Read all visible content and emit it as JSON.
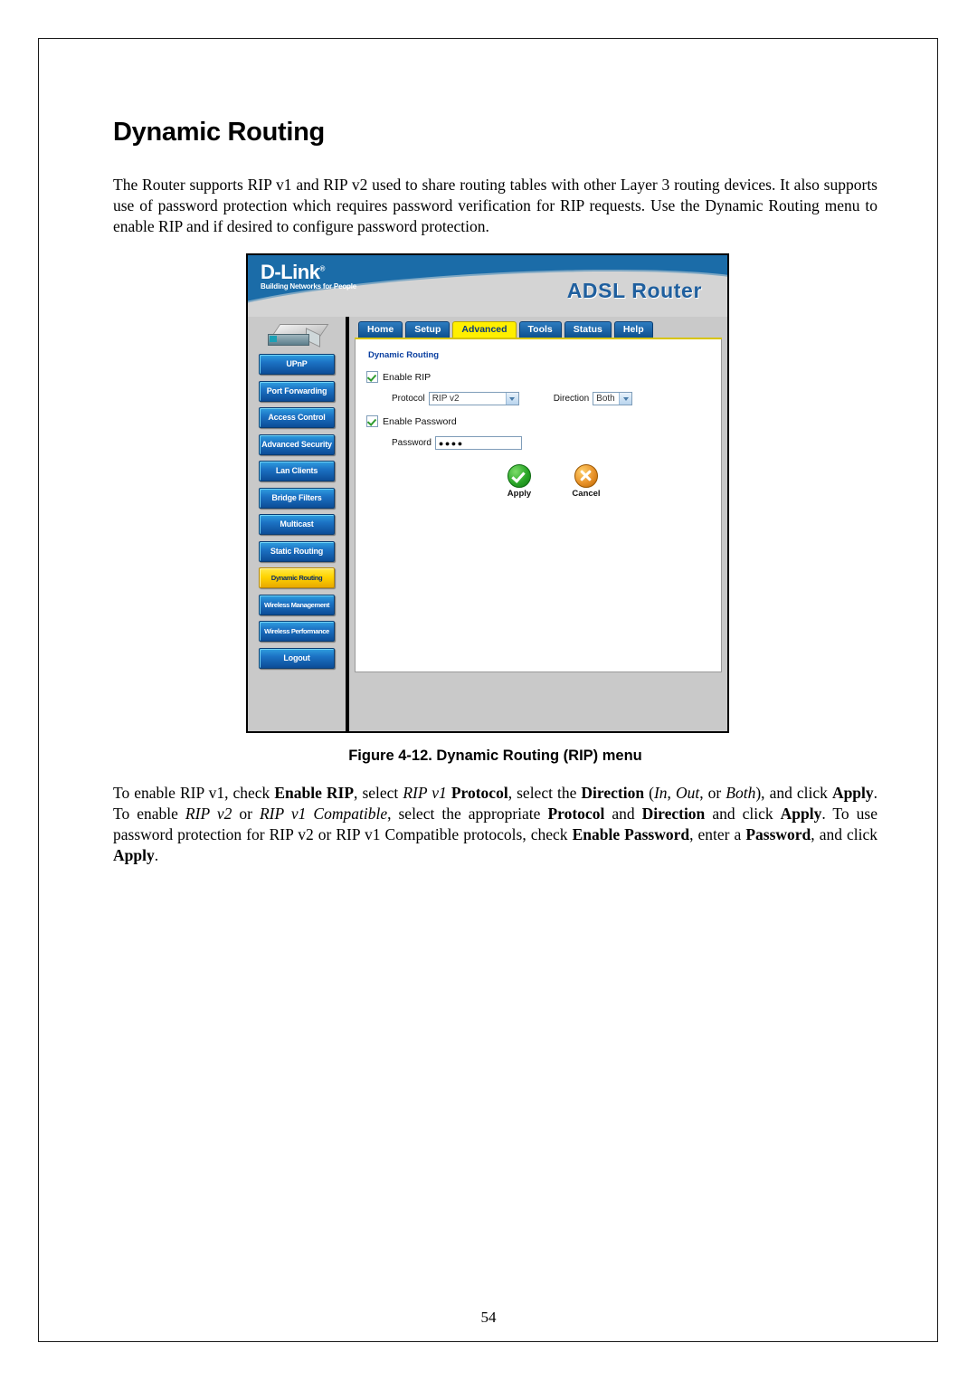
{
  "document": {
    "heading": "Dynamic Routing",
    "intro_paragraph": "The Router supports RIP v1 and RIP v2 used to share routing tables with other Layer 3 routing devices. It also supports use of password protection which requires password verification for RIP requests. Use the Dynamic Routing menu to enable RIP and if desired to configure password protection.",
    "figure_caption": "Figure 4-12. Dynamic Routing (RIP) menu",
    "page_number": "54"
  },
  "router_ui": {
    "brand": {
      "name": "D-Link",
      "trademark": "®",
      "tagline": "Building Networks for People",
      "product_title": "ADSL Router"
    },
    "tabs": [
      {
        "label": "Home",
        "active": false
      },
      {
        "label": "Setup",
        "active": false
      },
      {
        "label": "Advanced",
        "active": true
      },
      {
        "label": "Tools",
        "active": false
      },
      {
        "label": "Status",
        "active": false
      },
      {
        "label": "Help",
        "active": false
      }
    ],
    "sidebar": {
      "device_icon": "router-device-icon",
      "items": [
        {
          "label": "UPnP",
          "active": false,
          "small": false
        },
        {
          "label": "Port Forwarding",
          "active": false,
          "small": false
        },
        {
          "label": "Access Control",
          "active": false,
          "small": false
        },
        {
          "label": "Advanced Security",
          "active": false,
          "small": false
        },
        {
          "label": "Lan Clients",
          "active": false,
          "small": false
        },
        {
          "label": "Bridge Filters",
          "active": false,
          "small": false
        },
        {
          "label": "Multicast",
          "active": false,
          "small": false
        },
        {
          "label": "Static Routing",
          "active": false,
          "small": false
        },
        {
          "label": "Dynamic Routing",
          "active": true,
          "small": true
        },
        {
          "label": "Wireless Management",
          "active": false,
          "small": true
        },
        {
          "label": "Wireless Performance",
          "active": false,
          "small": true
        },
        {
          "label": "Logout",
          "active": false,
          "small": false
        }
      ]
    },
    "panel": {
      "title": "Dynamic Routing",
      "enable_rip_label": "Enable RIP",
      "enable_rip_checked": true,
      "protocol_label": "Protocol",
      "protocol_value": "RIP v2",
      "protocol_options": [
        "RIP v1",
        "RIP v2",
        "RIP v1 Compatible"
      ],
      "direction_label": "Direction",
      "direction_value": "Both",
      "direction_options": [
        "In",
        "Out",
        "Both"
      ],
      "enable_password_label": "Enable Password",
      "enable_password_checked": true,
      "password_label": "Password",
      "password_value": "●●●●",
      "apply_label": "Apply",
      "cancel_label": "Cancel"
    },
    "colors": {
      "header_blue": "#1b6ca8",
      "tab_active_yellow": "#ffef00",
      "sidebar_active_yellow": "#ffd400",
      "panel_title_blue": "#0a3fa0",
      "apply_green": "#2aa628",
      "cancel_orange": "#e8922a"
    }
  }
}
